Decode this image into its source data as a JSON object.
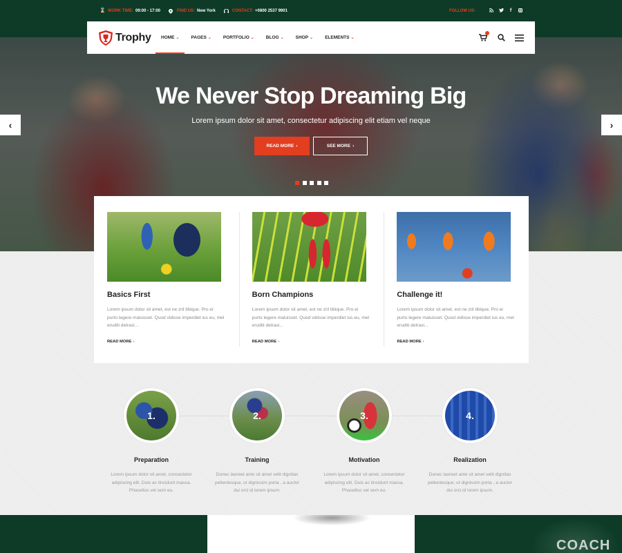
{
  "topbar": {
    "work_time_key": "WORK TIME:",
    "work_time_val": "09:00 - 17:00",
    "find_us_key": "FIND US:",
    "find_us_val": "New York",
    "contact_key": "CONTACT:",
    "contact_val": "+0800 2537 9901",
    "follow_us": "FOLLOW US:",
    "social": [
      "rss-icon",
      "twitter-icon",
      "facebook-icon",
      "instagram-icon"
    ]
  },
  "nav": {
    "logo": "Trophy",
    "items": [
      {
        "label": "HOME"
      },
      {
        "label": "PAGES"
      },
      {
        "label": "PORTFOLIO"
      },
      {
        "label": "BLOG"
      },
      {
        "label": "SHOP"
      },
      {
        "label": "ELEMENTS"
      }
    ]
  },
  "hero": {
    "title": "We Never Stop Dreaming Big",
    "subtitle": "Lorem ipsum dolor sit amet, consectetur adipiscing elit etiam vel neque",
    "btn_read": "READ MORE",
    "btn_see": "SEE MORE",
    "active_slide": 1,
    "slide_count": 5
  },
  "cards": [
    {
      "title": "Basics First",
      "text": "Lorem ipsum dolor sit amet, est ne zril tibique. Pro ei purto legere maluisset. Quod vidisse imperdiet ius eu, mel eruditi detraxi...",
      "link": "READ MORE"
    },
    {
      "title": "Born Champions",
      "text": "Lorem ipsum dolor sit amet, est ne zril tibique. Pro ei purto legere maluisset. Quod vidisse imperdiet ius eu, mel eruditi detraxi...",
      "link": "READ MORE"
    },
    {
      "title": "Challenge it!",
      "text": "Lorem ipsum dolor sit amet, est ne zril tibique. Pro ei purto legere maluisset. Quod vidisse imperdiet ius eu, mel eruditi detraxi...",
      "link": "READ MORE"
    }
  ],
  "steps": [
    {
      "num": "1.",
      "title": "Preparation",
      "text": "Lorem ipsum dolor sit amet, consectetur adipiscing elit. Duis ac tincidunt massa. Phasellus vel sem eu."
    },
    {
      "num": "2.",
      "title": "Training",
      "text": "Donec laoreet ante sit amet velit dignitas pellentesque, ut dignissim porta , a auctor dui orci id lorem ipsum."
    },
    {
      "num": "3.",
      "title": "Motivation",
      "text": "Lorem ipsum dolor sit amet, consectetur adipiscing elit. Duis ac tincidunt massa. Phasellus vel sem eu."
    },
    {
      "num": "4.",
      "title": "Realization",
      "text": "Donec laoreet ante sit amet velit dignitas pellentesque, ut dignissim porta , a auctor dui orci id lorem ipsum."
    }
  ],
  "bottom": {
    "coach_text": "COACH"
  },
  "colors": {
    "brand_green": "#0d3b27",
    "accent_red": "#e23e1f"
  }
}
